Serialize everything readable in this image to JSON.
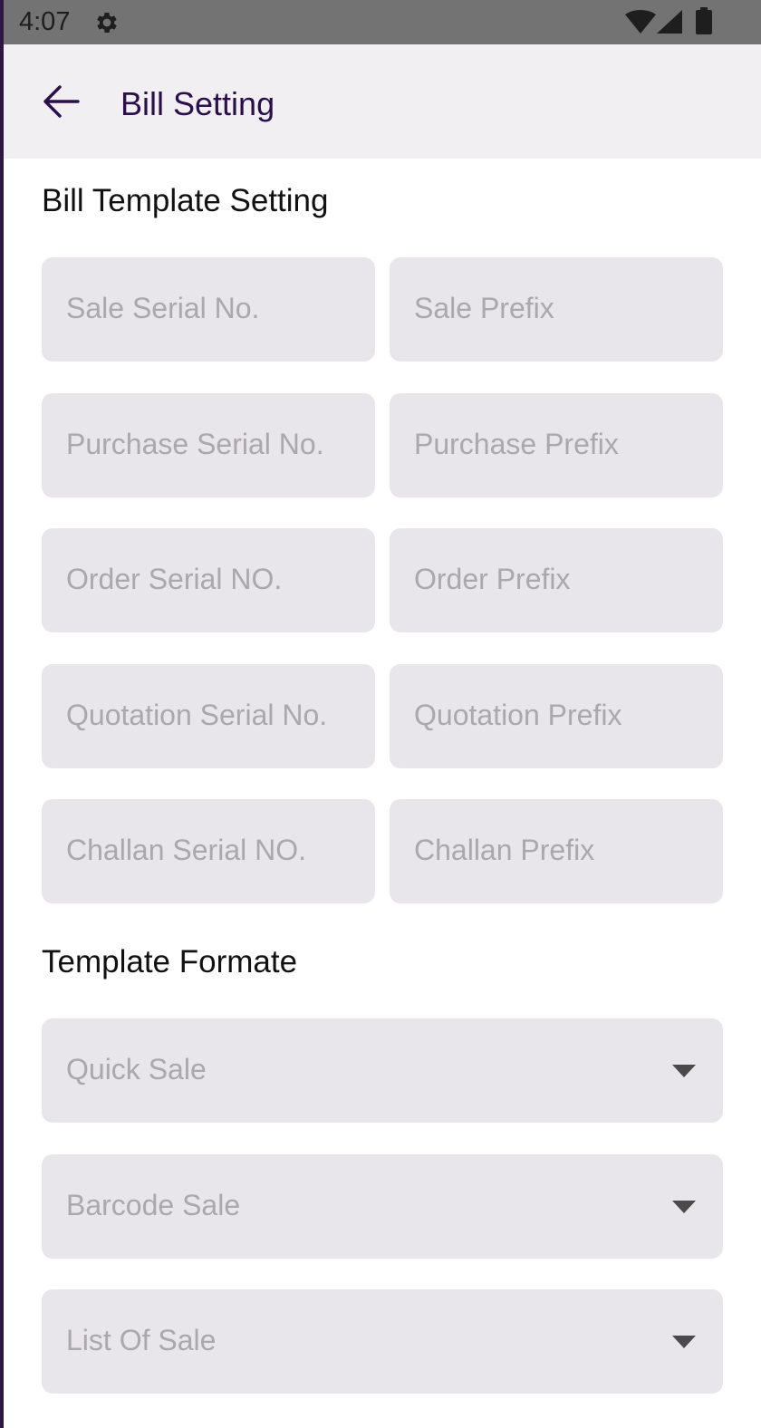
{
  "status_bar": {
    "time": "4:07",
    "icons": [
      "gear-icon",
      "wifi-icon",
      "signal-icon",
      "battery-icon"
    ]
  },
  "app_bar": {
    "back_icon": "arrow-left-icon",
    "title": "Bill Setting"
  },
  "bill_template_setting": {
    "heading": "Bill Template Setting",
    "fields": [
      {
        "serial_placeholder": "Sale Serial No.",
        "prefix_placeholder": "Sale Prefix"
      },
      {
        "serial_placeholder": "Purchase Serial No.",
        "prefix_placeholder": "Purchase Prefix"
      },
      {
        "serial_placeholder": "Order Serial NO.",
        "prefix_placeholder": "Order Prefix"
      },
      {
        "serial_placeholder": "Quotation Serial No.",
        "prefix_placeholder": "Quotation Prefix"
      },
      {
        "serial_placeholder": "Challan Serial NO.",
        "prefix_placeholder": "Challan Prefix"
      }
    ]
  },
  "template_format": {
    "heading": "Template Formate",
    "dropdowns": [
      {
        "placeholder": "Quick Sale",
        "icon": "caret-down-icon"
      },
      {
        "placeholder": "Barcode Sale",
        "icon": "caret-down-icon"
      },
      {
        "placeholder": "List Of Sale",
        "icon": "caret-down-icon"
      }
    ]
  },
  "colors": {
    "status_bar_bg": "#737373",
    "app_bar_bg": "#f1eff2",
    "title_color": "#2a0f4a",
    "field_bg": "#e8e6ea",
    "placeholder_color": "#aaa7ad"
  }
}
